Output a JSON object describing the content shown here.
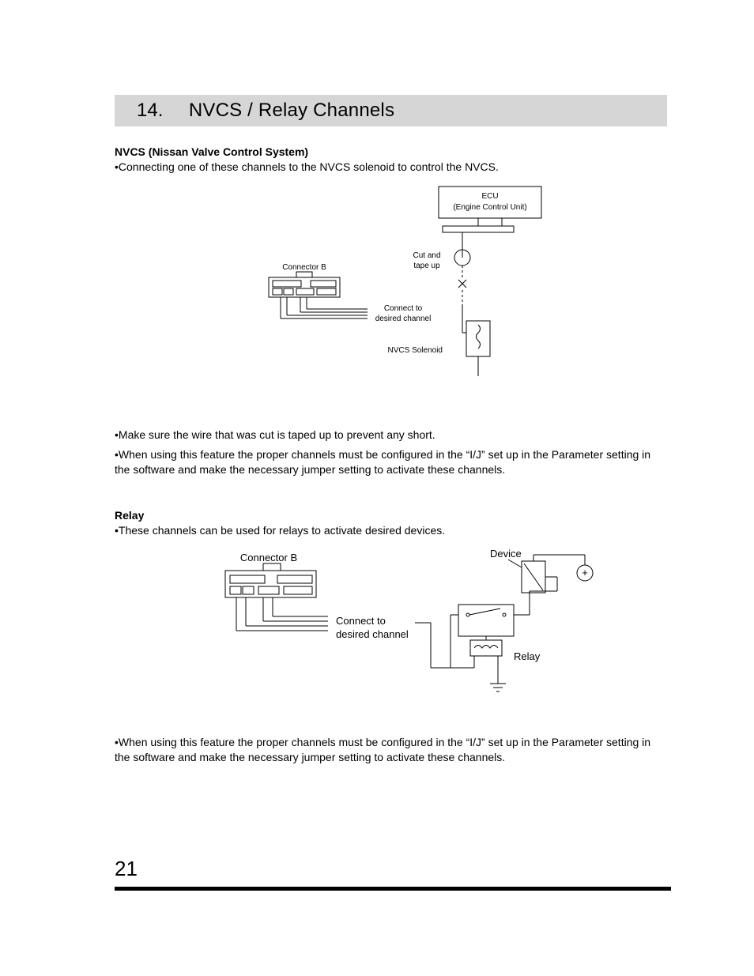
{
  "section": {
    "number": "14.",
    "title": "NVCS / Relay Channels"
  },
  "nvcs": {
    "heading": "NVCS (Nissan Valve Control System)",
    "para1": "•Connecting one of these channels to the NVCS solenoid to control the NVCS.",
    "para2": "•Make sure the wire that was cut is taped up to prevent any short.",
    "para3": "•When using this feature the proper channels must be configured in the “I/J” set up in the Parameter setting in the software and make the necessary jumper setting to activate these channels."
  },
  "nvcs_diagram": {
    "ecu_line1": "ECU",
    "ecu_line2": "(Engine Control Unit)",
    "connector_b": "Connector B",
    "cut_and_tape1": "Cut and",
    "cut_and_tape2": "tape up",
    "connect_to1": "Connect to",
    "connect_to2": "desired channel",
    "solenoid": "NVCS Solenoid"
  },
  "relay": {
    "heading": "Relay",
    "para1": "•These channels can be used for relays to activate desired devices.",
    "para2": "•When using this feature the proper channels must be configured in the “I/J” set up in the Parameter setting in the software and make the necessary jumper setting to activate these channels."
  },
  "relay_diagram": {
    "connector_b": "Connector B",
    "connect_to1": "Connect to",
    "connect_to2": "desired channel",
    "device": "Device",
    "relay_label": "Relay",
    "plus": "+"
  },
  "page_number": "21"
}
